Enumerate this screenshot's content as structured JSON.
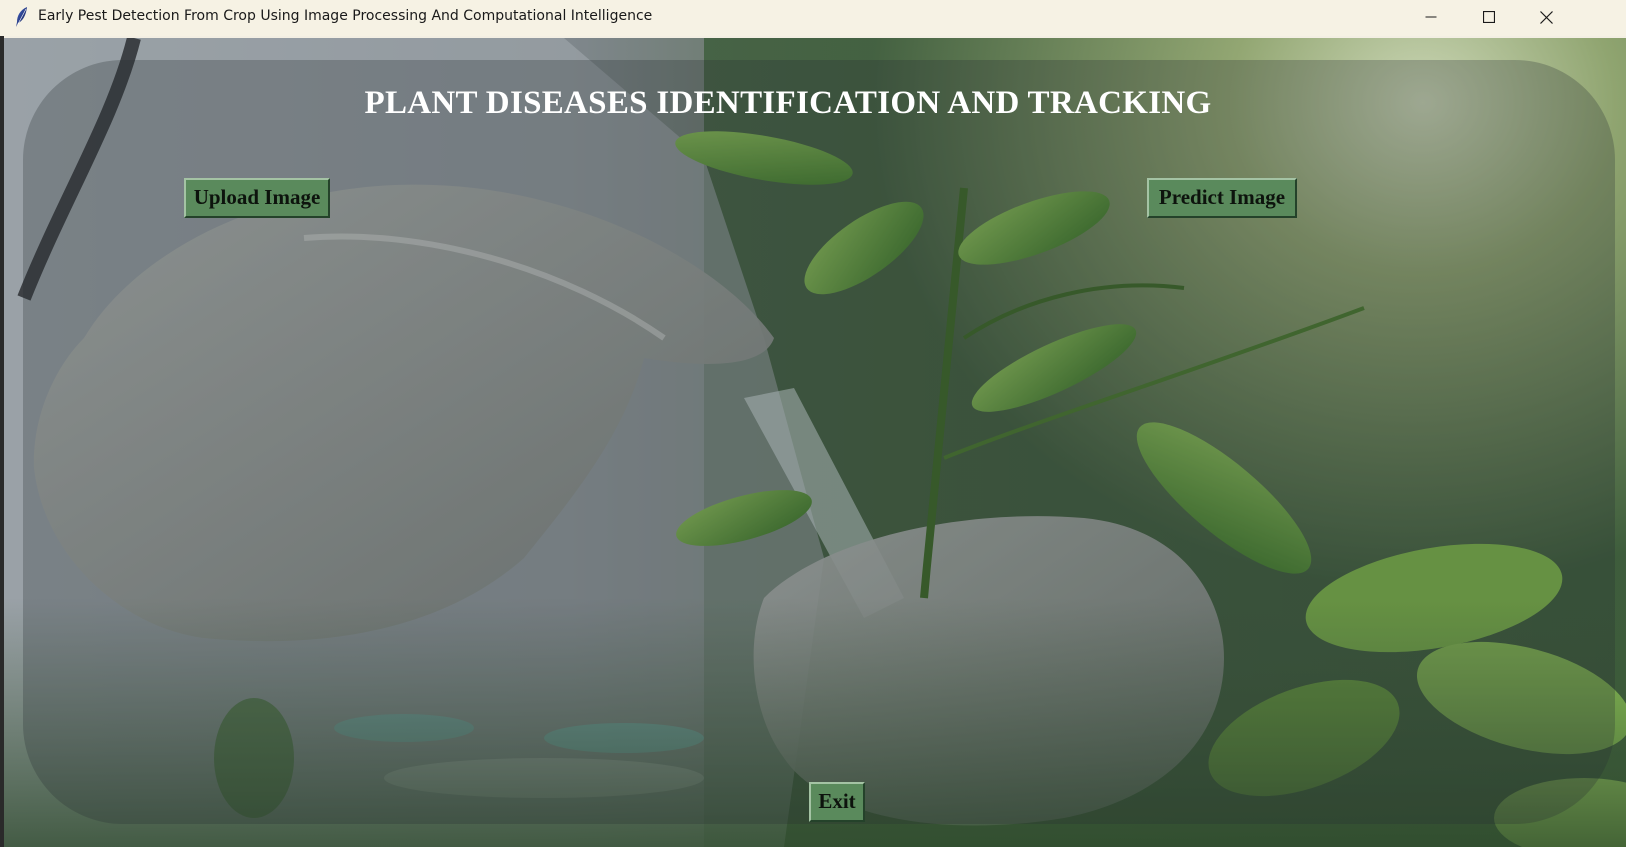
{
  "window": {
    "title": "Early Pest Detection From Crop Using Image Processing And Computational Intelligence",
    "app_icon": "feather-icon",
    "controls": {
      "minimize": "minimize-icon",
      "maximize": "maximize-icon",
      "close": "close-icon"
    }
  },
  "main": {
    "heading": "PLANT DISEASES IDENTIFICATION AND TRACKING",
    "background_image": "gloved-hands-holding-plant-seedling-photo",
    "buttons": {
      "upload_label": "Upload Image",
      "predict_label": "Predict Image",
      "exit_label": "Exit"
    }
  },
  "colors": {
    "button_bg": "#5a8a5c",
    "heading_text": "#ffffff",
    "titlebar_bg": "#f6f2e4"
  }
}
